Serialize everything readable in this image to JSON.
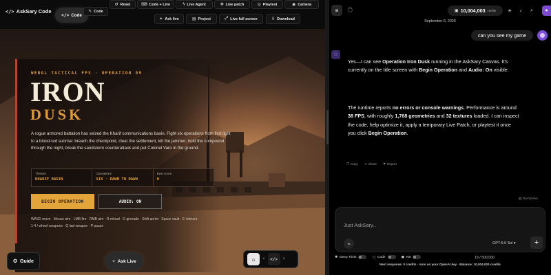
{
  "app": {
    "name": "AskSary Code",
    "code_toggle_label": "Code",
    "code_button_label": "Code"
  },
  "toolbar": {
    "row1": [
      "Reset",
      "Code + Live",
      "Live Agent",
      "Live patch",
      "Playtest",
      "Camera"
    ],
    "row2": [
      "Ask live",
      "Project",
      "Live full screen",
      "Download"
    ]
  },
  "game": {
    "subtitle": "WEBGL TACTICAL FPS · OPERATION 09",
    "title_line1": "IRON",
    "title_line2": "DUSK",
    "description": "A rogue armored battalion has seized the Kharif communications basin. Fight six operations from first light to a blood-red sunrise: breach the checkpoint, clear the settlement, kill the jammer, hold the compound through the night, break the sandstorm counterattack and put Colonel Varo in the ground.",
    "stats": [
      {
        "label": "Theatre",
        "value": "KHARIF BASIN"
      },
      {
        "label": "Operations",
        "value": "SIX · DAWN TO DAWN"
      },
      {
        "label": "Best score",
        "value": "0"
      }
    ],
    "begin_label": "BEGIN OPERATION",
    "audio_label": "AUDIO: ON",
    "controls_line1": "WASD move · Mouse aim · LMB fire · RMB aim · R reload · G grenade · Shift sprint · Space vault · E interact ·",
    "controls_line2": "1-4 / wheel weapons · Q last weapon · P pause"
  },
  "bottom_left": {
    "guide_label": "Guide",
    "ask_live_label": "Ask Live"
  },
  "chat": {
    "credits_value": "10,004,003",
    "credits_label": "credits",
    "date": "September 6, 2026",
    "user_message": "can you see my game",
    "ai_p1_parts": [
      "Yes—I can see ",
      "Operation Iron Dusk",
      " running in the AskSary Canvas. It's currently on the title screen with ",
      "Begin Operation",
      " and ",
      "Audio: On",
      " visible."
    ],
    "ai_p2_parts": [
      "The runtime reports ",
      "no errors or console warnings",
      ". Performance is around ",
      "38 FPS",
      ", with roughly ",
      "1,768 geometries",
      " and ",
      "32 textures",
      " loaded. I can inspect the code, help optimize it, apply a temporary Live Patch, or playtest it once you click ",
      "Begin Operation",
      "."
    ],
    "actions": [
      "Copy",
      "Share",
      "Report"
    ],
    "watermark": "DevWorks",
    "composer_placeholder": "Just AskSary..",
    "model": "GPT-5.6 Sol",
    "toggles": [
      "Deep Think",
      "Code",
      "KB"
    ],
    "tokens": "19 / 500,000",
    "footer": "Next response: 0 credits · runs on your OpenAI key · Balance: 10,004,003 credits"
  },
  "colors": {
    "accent_orange": "#e3a53a",
    "title_red": "#b5452a",
    "chat_avatar": "#7a4fd6"
  }
}
